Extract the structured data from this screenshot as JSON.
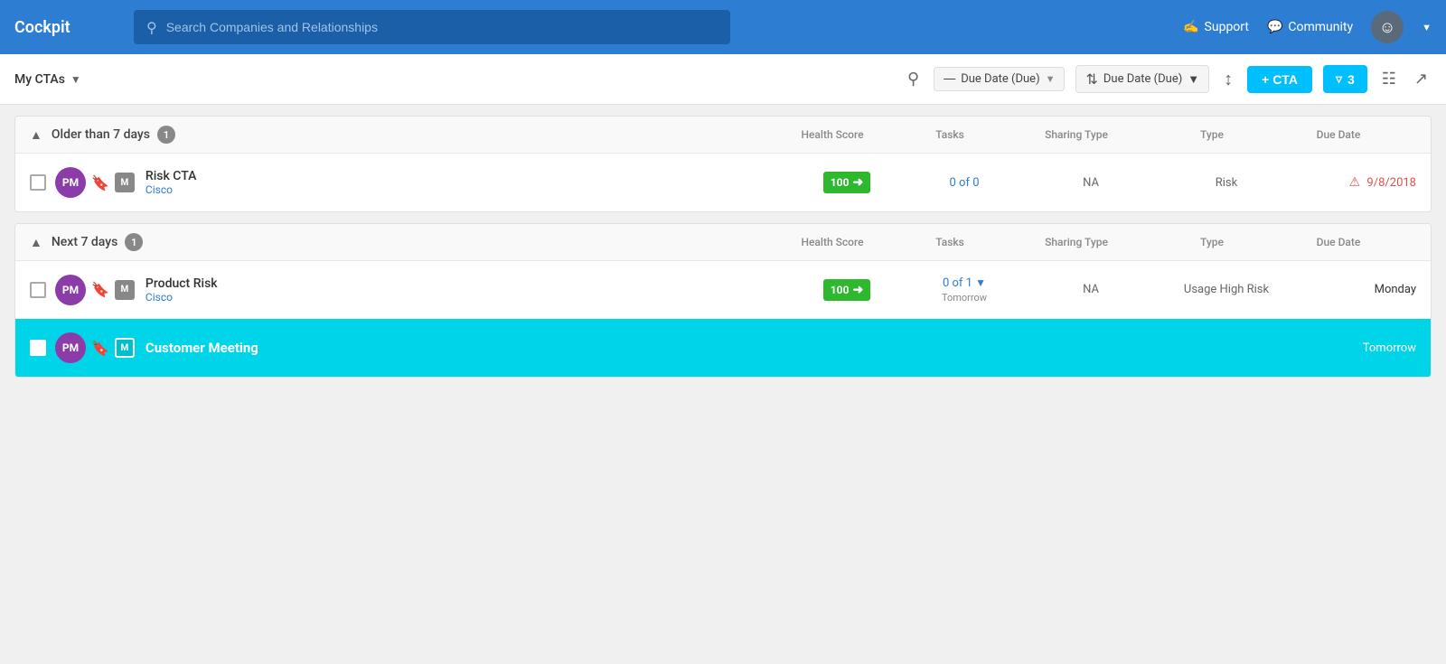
{
  "app": {
    "title": "Cockpit"
  },
  "nav": {
    "search_placeholder": "Search Companies and Relationships",
    "support_label": "Support",
    "community_label": "Community"
  },
  "toolbar": {
    "view_label": "My CTAs",
    "group_by_label": "Due Date (Due)",
    "sort_by_label": "Due Date (Due)",
    "add_cta_label": "+ CTA",
    "filter_count": "3"
  },
  "group1": {
    "title": "Older than 7 days",
    "count": "1",
    "columns": [
      "Health Score",
      "Tasks",
      "Sharing Type",
      "Type",
      "Due Date"
    ],
    "row": {
      "initials": "PM",
      "badge": "M",
      "name": "Risk CTA",
      "company": "Cisco",
      "health_score": "100",
      "tasks": "0 of 0",
      "sharing_type": "NA",
      "type": "Risk",
      "due_date": "9/8/2018",
      "overdue": true
    }
  },
  "group2": {
    "title": "Next 7 days",
    "count": "1",
    "columns": [
      "Health Score",
      "Tasks",
      "Sharing Type",
      "Type",
      "Due Date"
    ],
    "row1": {
      "initials": "PM",
      "badge": "M",
      "name": "Product Risk",
      "company": "Cisco",
      "health_score": "100",
      "tasks": "0 of 1",
      "tasks_due": "Tomorrow",
      "sharing_type": "NA",
      "type": "Usage High Risk",
      "due_date": "Monday"
    },
    "row2": {
      "initials": "PM",
      "badge": "M",
      "name": "Customer Meeting",
      "due_date": "Tomorrow",
      "highlighted": true
    }
  }
}
